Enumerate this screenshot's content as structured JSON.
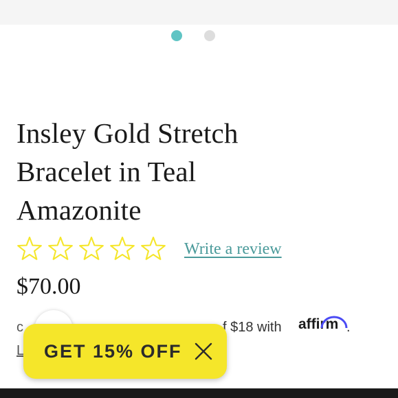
{
  "gallery": {
    "dots": [
      {
        "active": true
      },
      {
        "active": false
      }
    ],
    "active_color": "#5fc4c4"
  },
  "product": {
    "title_lines": [
      "Insley Gold Stretch",
      "Bracelet in Teal",
      "Amazonite"
    ],
    "rating": {
      "stars_total": 5,
      "stars_filled": 0,
      "star_color": "#f5e62a"
    },
    "review_link": "Write a review",
    "price": "$70.00"
  },
  "financing": {
    "lead_fragment": "c",
    "text": "f $18 with",
    "brand": "affirm",
    "period": ".",
    "learn_fragment": "L"
  },
  "promo": {
    "label": "GET 15% OFF",
    "close_icon": "close-icon",
    "background": "#f5e62a"
  }
}
